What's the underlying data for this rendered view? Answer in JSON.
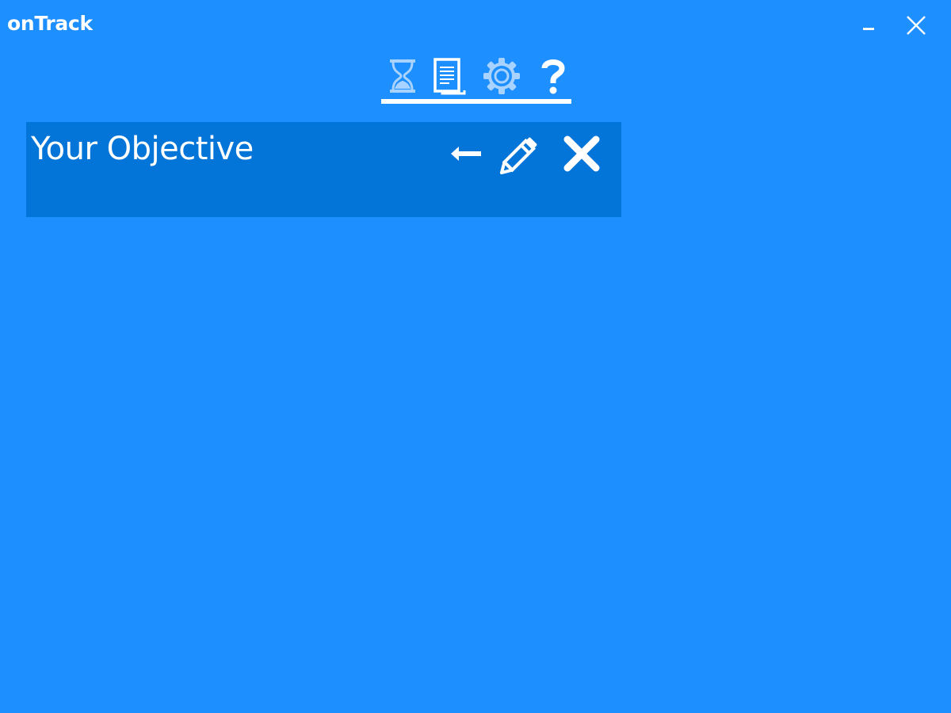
{
  "window": {
    "title": "onTrack",
    "controls": {
      "minimize_icon": "minimize-icon",
      "close_icon": "close-icon"
    }
  },
  "nav": {
    "items": [
      {
        "id": "timer",
        "icon": "hourglass-icon"
      },
      {
        "id": "objectives",
        "icon": "document-icon"
      },
      {
        "id": "settings",
        "icon": "gear-icon"
      },
      {
        "id": "help",
        "icon": "question-icon"
      }
    ]
  },
  "objective": {
    "title": "Your Objective",
    "actions": [
      {
        "id": "back",
        "icon": "arrow-left-icon"
      },
      {
        "id": "edit",
        "icon": "pencil-icon"
      },
      {
        "id": "delete",
        "icon": "close-icon"
      }
    ]
  },
  "colors": {
    "background": "#1e8fff",
    "card": "#0375d8",
    "foreground": "#ffffff",
    "inactive_icon": "#a8d2ff"
  }
}
